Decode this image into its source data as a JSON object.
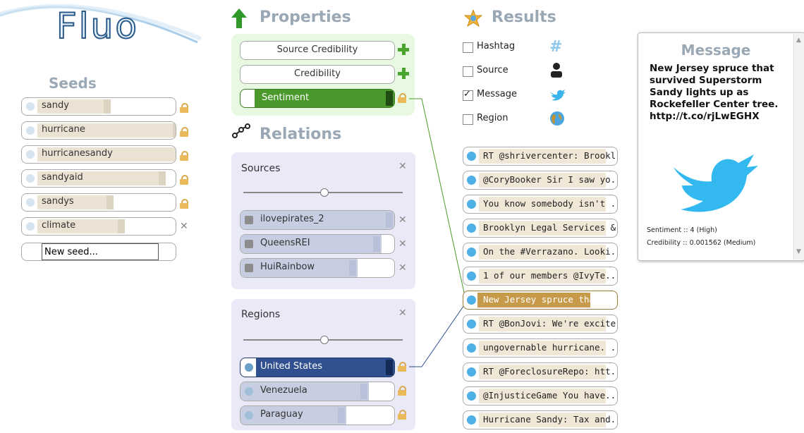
{
  "app": {
    "logo": "Fluo"
  },
  "seeds": {
    "title": "Seeds",
    "items": [
      {
        "label": "sandy"
      },
      {
        "label": "hurricane"
      },
      {
        "label": "hurricanesandy"
      },
      {
        "label": "sandyaid"
      },
      {
        "label": "sandys"
      },
      {
        "label": "climate"
      }
    ],
    "new_seed_placeholder": "New seed..."
  },
  "properties": {
    "title": "Properties",
    "items": [
      {
        "label": "Source Credibility"
      },
      {
        "label": "Credibility"
      },
      {
        "label": "Sentiment"
      }
    ]
  },
  "relations": {
    "title": "Relations",
    "sources": {
      "title": "Sources",
      "items": [
        {
          "label": "ilovepirates_2"
        },
        {
          "label": "QueensREI"
        },
        {
          "label": "HuiRainbow"
        }
      ]
    },
    "regions": {
      "title": "Regions",
      "items": [
        {
          "label": "United States"
        },
        {
          "label": "Venezuela"
        },
        {
          "label": "Paraguay"
        }
      ]
    }
  },
  "results": {
    "title": "Results",
    "filters": [
      {
        "label": "Hashtag",
        "checked": false,
        "icon": "hashtag-icon"
      },
      {
        "label": "Source",
        "checked": false,
        "icon": "user-icon"
      },
      {
        "label": "Message",
        "checked": true,
        "icon": "twitter-bird-icon"
      },
      {
        "label": "Region",
        "checked": false,
        "icon": "globe-icon"
      }
    ],
    "items": [
      {
        "text": "RT @shrivercenter: Brookl..."
      },
      {
        "text": "@CoryBooker Sir I saw yo..."
      },
      {
        "text": "You know somebody isn't ..."
      },
      {
        "text": "Brooklyn Legal Services &..."
      },
      {
        "text": "On the #Verrazano. Looki..."
      },
      {
        "text": "1 of our members @IvyTe..."
      },
      {
        "text": "New Jersey spruce that su..."
      },
      {
        "text": "RT @BonJovi: We're excite..."
      },
      {
        "text": "ungovernable hurricane. ..."
      },
      {
        "text": "RT @ForeclosureRepo: htt..."
      },
      {
        "text": "@InjusticeGame You have..."
      },
      {
        "text": "Hurricane Sandy: Tax and..."
      }
    ]
  },
  "message": {
    "title": "Message",
    "body": "New Jersey spruce that survived Superstorm Sandy lights up as Rockefeller Center tree. http://t.co/rjLwEGHX",
    "sentiment": "Sentiment :: 4 (High)",
    "credibility": "Credibility :: 0.001562 (Medium)"
  },
  "colors": {
    "accent_green": "#4c9a2a",
    "accent_blue": "#30508f",
    "highlight_gold": "#c79a4a",
    "twitter_blue": "#35b5ef"
  }
}
